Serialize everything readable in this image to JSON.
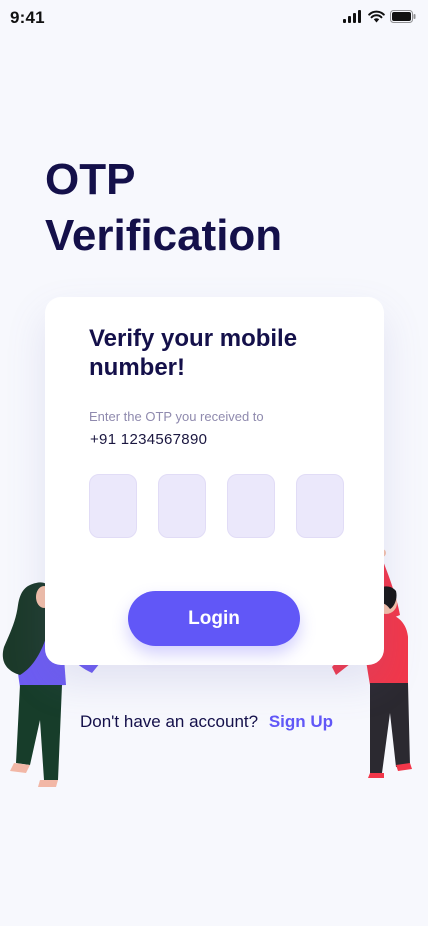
{
  "status_bar": {
    "time": "9:41",
    "icons": [
      "signal-icon",
      "wifi-icon",
      "battery-icon"
    ]
  },
  "page": {
    "title_line1": "OTP",
    "title_line2": "Verification"
  },
  "card": {
    "heading": "Verify your mobile number!",
    "hint": "Enter the OTP you received to",
    "phone": "+91 1234567890",
    "otp_boxes": [
      "",
      "",
      "",
      ""
    ],
    "login_label": "Login"
  },
  "footer": {
    "prompt": "Don't have an account?",
    "signup_label": "Sign Up"
  },
  "colors": {
    "background": "#f7f8fd",
    "title": "#14104a",
    "accent": "#6157f7",
    "otp_box": "#ebe8fb"
  }
}
